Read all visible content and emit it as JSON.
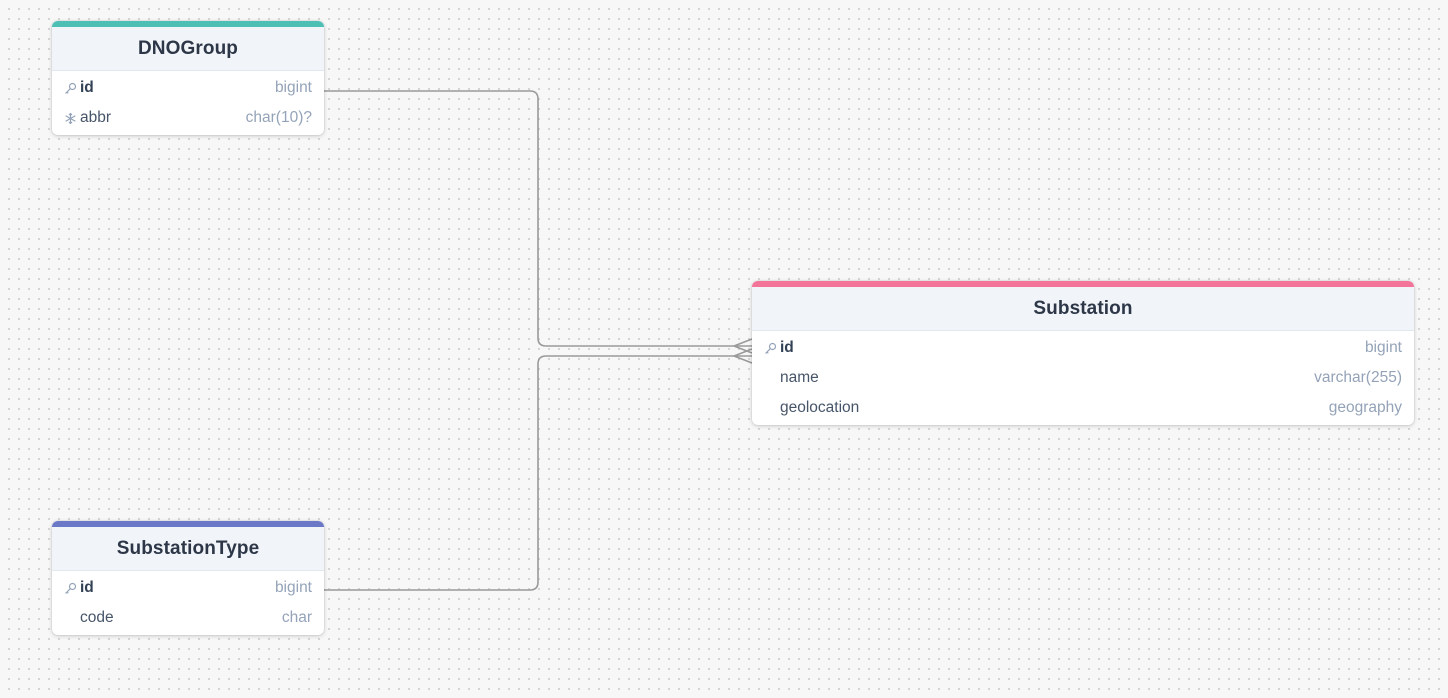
{
  "colors": {
    "dnogroup_accent": "#4dbfb5",
    "substationtype_accent": "#6b78c8",
    "substation_accent": "#f47399",
    "edge": "#9a9a9a"
  },
  "tables": {
    "dnogroup": {
      "name": "DNOGroup",
      "fields": [
        {
          "name": "id",
          "type": "bigint",
          "icon": "key-icon",
          "pk": true
        },
        {
          "name": "abbr",
          "type": "char(10)?",
          "icon": "snowflake-icon",
          "pk": false
        }
      ]
    },
    "substationtype": {
      "name": "SubstationType",
      "fields": [
        {
          "name": "id",
          "type": "bigint",
          "icon": "key-icon",
          "pk": true
        },
        {
          "name": "code",
          "type": "char",
          "icon": "",
          "pk": false
        }
      ]
    },
    "substation": {
      "name": "Substation",
      "fields": [
        {
          "name": "id",
          "type": "bigint",
          "icon": "key-icon",
          "pk": true
        },
        {
          "name": "name",
          "type": "varchar(255)",
          "icon": "",
          "pk": false
        },
        {
          "name": "geolocation",
          "type": "geography",
          "icon": "",
          "pk": false
        }
      ]
    }
  },
  "relations": [
    {
      "from": "DNOGroup.id",
      "to": "Substation.id",
      "cardinality": "one-to-many"
    },
    {
      "from": "SubstationType.id",
      "to": "Substation.id",
      "cardinality": "one-to-many"
    }
  ]
}
